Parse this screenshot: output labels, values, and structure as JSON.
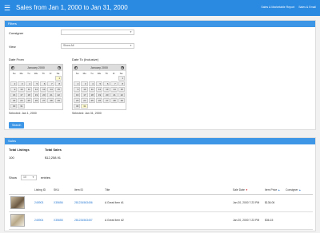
{
  "header": {
    "menu_icon": "menu-icon",
    "title": "Sales from Jan 1, 2000 to Jan 31, 2000",
    "links": [
      "Sales & Marketable Report",
      "Sales & Email"
    ]
  },
  "filters": {
    "heading": "Filters",
    "consigner_label": "Consigner",
    "consigner_value": "",
    "view_label": "View",
    "view_value": "Show All",
    "date_from_label": "Date From",
    "date_to_label": "Date To (Inclusive)",
    "calendar_month": "January 2000",
    "days_of_week": [
      "Su",
      "Mo",
      "Tu",
      "We",
      "Th",
      "Fr",
      "Sa"
    ],
    "weeks": [
      [
        "",
        "",
        "",
        "",
        "",
        "",
        "1"
      ],
      [
        "2",
        "3",
        "4",
        "5",
        "6",
        "7",
        "8"
      ],
      [
        "9",
        "10",
        "11",
        "12",
        "13",
        "14",
        "15"
      ],
      [
        "16",
        "17",
        "18",
        "19",
        "20",
        "21",
        "22"
      ],
      [
        "23",
        "24",
        "25",
        "26",
        "27",
        "28",
        "29"
      ],
      [
        "30",
        "31",
        "",
        "",
        "",
        "",
        ""
      ]
    ],
    "selected_from": "Selected: Jan 1, 2000",
    "selected_to": "Selected: Jan 31, 2000",
    "search_label": "Search"
  },
  "sales": {
    "heading": "Sales",
    "total_listings_label": "Total Listings",
    "total_listings_value": "100",
    "total_sales_label": "Total Sales",
    "total_sales_value": "$12,258.91",
    "show_label": "Show",
    "per_page": "10",
    "entries_label": "entries",
    "columns": [
      "",
      "Listing ID",
      "SKU",
      "Item ID",
      "Title",
      "Sale Date",
      "Item Price",
      "Consigner"
    ],
    "rows": [
      {
        "listing_id": "245903",
        "sku": "X35656",
        "item_id": "281234563456",
        "title": "A Great Item #1",
        "sale_date": "Jan 20, 2000 7:23 PM",
        "price": "$136.06",
        "consigner": ""
      },
      {
        "listing_id": "245904",
        "sku": "X35655",
        "item_id": "281234563457",
        "title": "A Great Item #2",
        "sale_date": "Jan 20, 2000 7:23 PM",
        "price": "$36.15",
        "consigner": ""
      }
    ]
  }
}
